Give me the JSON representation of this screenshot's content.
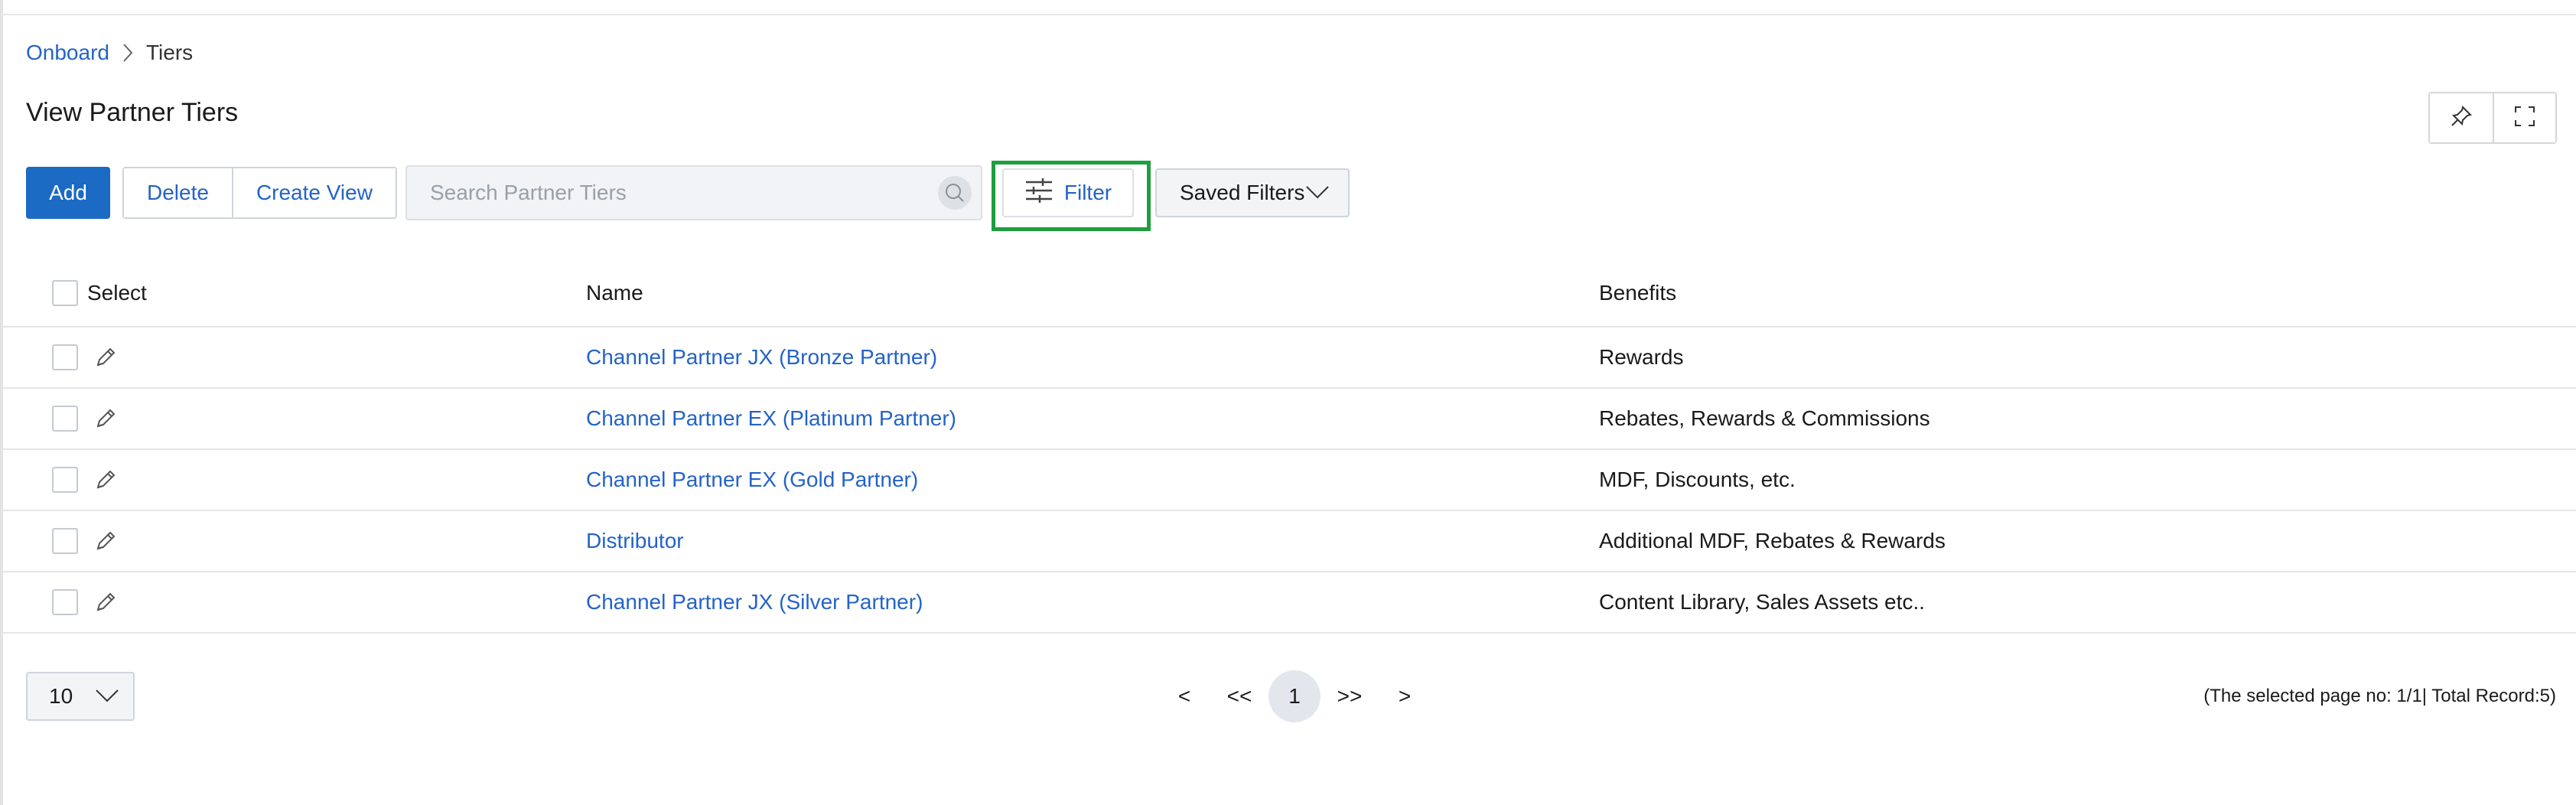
{
  "breadcrumb": {
    "parent": "Onboard",
    "current": "Tiers"
  },
  "page": {
    "title": "View Partner Tiers"
  },
  "toolbar": {
    "add_label": "Add",
    "delete_label": "Delete",
    "create_view_label": "Create View",
    "search_placeholder": "Search Partner Tiers",
    "filter_label": "Filter",
    "saved_filters_label": "Saved Filters"
  },
  "table": {
    "columns": {
      "select": "Select",
      "name": "Name",
      "benefits": "Benefits"
    },
    "rows": [
      {
        "name": "Channel Partner JX (Bronze Partner)",
        "benefits": "Rewards"
      },
      {
        "name": "Channel Partner EX (Platinum Partner)",
        "benefits": "Rebates, Rewards & Commissions"
      },
      {
        "name": "Channel Partner EX (Gold Partner)",
        "benefits": "MDF, Discounts, etc."
      },
      {
        "name": "Distributor",
        "benefits": "Additional MDF, Rebates & Rewards"
      },
      {
        "name": "Channel Partner JX (Silver Partner)",
        "benefits": "Content Library, Sales Assets etc.."
      }
    ]
  },
  "pagination": {
    "page_size": "10",
    "prev": "<",
    "first": "<<",
    "current": "1",
    "last": ">>",
    "next": ">",
    "info": "(The selected page no: 1/1| Total Record:5)"
  },
  "colors": {
    "accent": "#1b6ac4",
    "link": "#2463c7",
    "highlight": "#1e9e3e"
  },
  "icons": [
    "chevron-right-icon",
    "pin-icon",
    "fullscreen-icon",
    "search-icon",
    "filter-sliders-icon",
    "chevron-down-icon",
    "pencil-icon"
  ]
}
